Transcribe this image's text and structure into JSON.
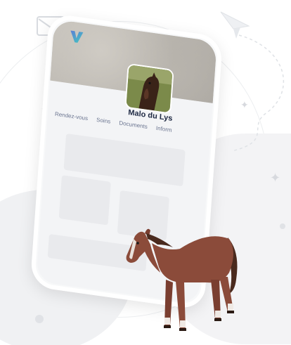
{
  "profile": {
    "name": "Malo du Lys"
  },
  "tabs": [
    {
      "label": "Rendez-vous"
    },
    {
      "label": "Soins"
    },
    {
      "label": "Documents"
    },
    {
      "label": "Inform"
    }
  ],
  "decor": {
    "icons": [
      "mail-icon",
      "paper-plane-icon",
      "sparkle-icon",
      "brand-logo"
    ],
    "accent": "#1f2a44",
    "brand_gradient": [
      "#5b7fd6",
      "#43c7c0"
    ],
    "horse_coat": "#8b4b3a"
  }
}
